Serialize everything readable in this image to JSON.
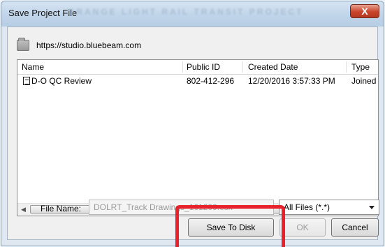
{
  "window": {
    "title": "Save Project File",
    "title_watermark": "ORANGE LIGHT RAIL TRANSIT PROJECT",
    "close_label": "X"
  },
  "location": {
    "url": "https://studio.bluebeam.com",
    "icon": "folder-icon"
  },
  "table": {
    "columns": [
      "Name",
      "Public ID",
      "Created Date",
      "Type"
    ],
    "rows": [
      {
        "icon": "document-icon",
        "name": "D-O QC Review",
        "public_id": "802-412-296",
        "created_date": "12/20/2016 3:57:33 PM",
        "type": "Joined"
      }
    ],
    "scroll_left": "◀",
    "scroll_right": "▶",
    "scroll_grip": "III"
  },
  "form": {
    "file_name_label": "File Name:",
    "file_name_value": "DOLRT_Track Drawings_161209.esx",
    "filter_value": "All Files (*.*)"
  },
  "buttons": {
    "save_to_disk": "Save To Disk",
    "ok": "OK",
    "cancel": "Cancel"
  },
  "colors": {
    "highlight": "#e8222a",
    "close_button": "#c9452b"
  }
}
